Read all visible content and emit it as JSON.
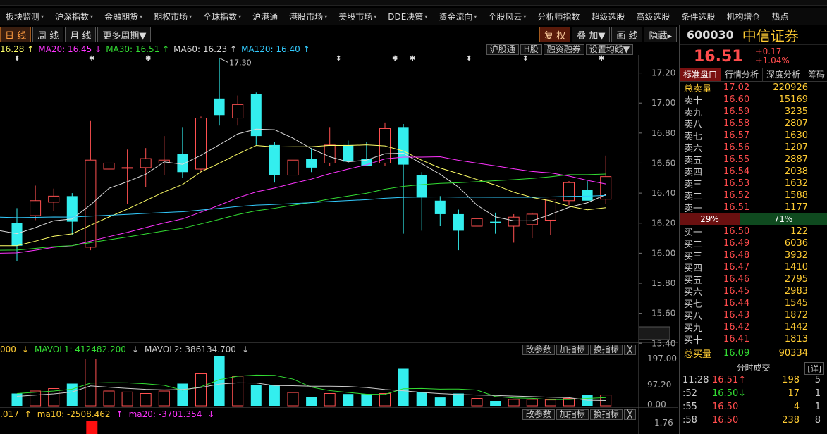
{
  "menu": [
    {
      "label": "板块监测",
      "arrow": true
    },
    {
      "label": "沪深指数",
      "arrow": true
    },
    {
      "label": "金融期货",
      "arrow": true
    },
    {
      "label": "期权市场",
      "arrow": true
    },
    {
      "label": "全球指数",
      "arrow": true
    },
    {
      "label": "沪港通",
      "arrow": false
    },
    {
      "label": "港股市场",
      "arrow": true
    },
    {
      "label": "美股市场",
      "arrow": true
    },
    {
      "label": "DDE决策",
      "arrow": true
    },
    {
      "label": "资金流向",
      "arrow": true
    },
    {
      "label": "个股风云",
      "arrow": true
    },
    {
      "label": "分析师指数",
      "arrow": false
    },
    {
      "label": "超级选股",
      "arrow": false
    },
    {
      "label": "高级选股",
      "arrow": false
    },
    {
      "label": "条件选股",
      "arrow": false
    },
    {
      "label": "机构增仓",
      "arrow": false
    },
    {
      "label": "热点",
      "arrow": false
    }
  ],
  "periods": [
    "日 线",
    "周 线",
    "月 线",
    "更多周期▼"
  ],
  "chart_buttons": [
    "复 权",
    "叠 加▼",
    "画 线",
    "隐藏▸"
  ],
  "ma_legend": [
    {
      "text": "16.28",
      "color": "#ffff66",
      "arrow": "↑"
    },
    {
      "text": "MA20: 16.45",
      "color": "#ff33ff",
      "arrow": "↓"
    },
    {
      "text": "MA30: 16.51",
      "color": "#33dd33",
      "arrow": "↑"
    },
    {
      "text": "MA60: 16.23",
      "color": "#dcdcdc",
      "arrow": "↑"
    },
    {
      "text": "MA120: 16.40",
      "color": "#33ccff",
      "arrow": "↑"
    }
  ],
  "legend_buttons": [
    "沪股通",
    "H股",
    "融资融券",
    "设置均线▼"
  ],
  "vol_legend": {
    "v0": "000",
    "mavol1": "MAVOL1: 412482.200",
    "mavol2": "MAVOL2: 386134.700"
  },
  "vol_buttons": [
    "改参数",
    "加指标",
    "换指标",
    "╳"
  ],
  "ind_legend": {
    "v0": ".017",
    "ma10": "ma10: -2508.462",
    "ma20": "ma20: -3701.354"
  },
  "stock": {
    "code": "600030",
    "name": "中信证券",
    "price": "16.51",
    "change": "+0.17",
    "change_pct": "+1.04%"
  },
  "tabs": [
    "标准盘口",
    "行情分析",
    "深度分析",
    "筹码"
  ],
  "ask_total": {
    "label": "总卖量",
    "price": "17.02",
    "vol": "220926"
  },
  "asks": [
    {
      "label": "卖十",
      "price": "16.60",
      "vol": "15169"
    },
    {
      "label": "卖九",
      "price": "16.59",
      "vol": "3235"
    },
    {
      "label": "卖八",
      "price": "16.58",
      "vol": "2807"
    },
    {
      "label": "卖七",
      "price": "16.57",
      "vol": "1630"
    },
    {
      "label": "卖六",
      "price": "16.56",
      "vol": "1207"
    },
    {
      "label": "卖五",
      "price": "16.55",
      "vol": "2887"
    },
    {
      "label": "卖四",
      "price": "16.54",
      "vol": "2038"
    },
    {
      "label": "卖三",
      "price": "16.53",
      "vol": "1632"
    },
    {
      "label": "卖二",
      "price": "16.52",
      "vol": "1588"
    },
    {
      "label": "卖一",
      "price": "16.51",
      "vol": "1177"
    }
  ],
  "ratio": {
    "buy": "29%",
    "sell": "71%"
  },
  "bids": [
    {
      "label": "买一",
      "price": "16.50",
      "vol": "122"
    },
    {
      "label": "买二",
      "price": "16.49",
      "vol": "6036"
    },
    {
      "label": "买三",
      "price": "16.48",
      "vol": "3932"
    },
    {
      "label": "买四",
      "price": "16.47",
      "vol": "1410"
    },
    {
      "label": "买五",
      "price": "16.46",
      "vol": "2795"
    },
    {
      "label": "买六",
      "price": "16.45",
      "vol": "2983"
    },
    {
      "label": "买七",
      "price": "16.44",
      "vol": "1545"
    },
    {
      "label": "买八",
      "price": "16.43",
      "vol": "1872"
    },
    {
      "label": "买九",
      "price": "16.42",
      "vol": "1442"
    },
    {
      "label": "买十",
      "price": "16.41",
      "vol": "1813"
    }
  ],
  "bid_total": {
    "label": "总买量",
    "price": "16.09",
    "vol": "90334"
  },
  "trades_header": "分时成交",
  "trades_detail": "[详]",
  "trades": [
    {
      "time": "11:28",
      "price": "16.51",
      "dir": "↑",
      "vol": "198",
      "n": "5",
      "color": "red"
    },
    {
      "time": ":52",
      "price": "16.50",
      "dir": "↓",
      "vol": "17",
      "n": "1",
      "color": "green"
    },
    {
      "time": ":55",
      "price": "16.50",
      "dir": "",
      "vol": "4",
      "n": "1",
      "color": "red"
    },
    {
      "time": ":58",
      "price": "16.50",
      "dir": "",
      "vol": "238",
      "n": "8",
      "color": "red"
    }
  ],
  "chart_data": {
    "type": "candlestick",
    "price_axis_labels": [
      "17.20",
      "17.00",
      "16.80",
      "16.60",
      "16.40",
      "16.20",
      "16.00",
      "15.80",
      "15.60",
      "15.40"
    ],
    "price_ylim": [
      15.42,
      17.32
    ],
    "high_marker": "17.30",
    "volume_axis_labels": [
      "197.00",
      "97.20",
      "0.00"
    ],
    "indicator_axis_labels": [
      "1.76"
    ],
    "candles": [
      {
        "o": 16.2,
        "h": 16.3,
        "l": 15.95,
        "c": 16.05
      },
      {
        "o": 16.25,
        "h": 16.45,
        "l": 16.22,
        "c": 16.35
      },
      {
        "o": 16.34,
        "h": 16.43,
        "l": 16.28,
        "c": 16.38
      },
      {
        "o": 16.38,
        "h": 16.4,
        "l": 16.12,
        "c": 16.21
      },
      {
        "o": 16.04,
        "h": 16.88,
        "l": 16.02,
        "c": 16.62
      },
      {
        "o": 16.56,
        "h": 16.72,
        "l": 16.5,
        "c": 16.6
      },
      {
        "o": 16.57,
        "h": 16.69,
        "l": 16.33,
        "c": 16.57
      },
      {
        "o": 16.57,
        "h": 16.7,
        "l": 16.44,
        "c": 16.63
      },
      {
        "o": 16.6,
        "h": 16.78,
        "l": 16.52,
        "c": 16.62
      },
      {
        "o": 16.66,
        "h": 16.84,
        "l": 16.5,
        "c": 16.54
      },
      {
        "o": 16.56,
        "h": 16.91,
        "l": 16.54,
        "c": 16.9
      },
      {
        "o": 17.03,
        "h": 17.3,
        "l": 16.85,
        "c": 16.92
      },
      {
        "o": 16.9,
        "h": 17.05,
        "l": 16.85,
        "c": 16.99
      },
      {
        "o": 17.06,
        "h": 17.07,
        "l": 16.72,
        "c": 16.78
      },
      {
        "o": 16.72,
        "h": 16.74,
        "l": 16.47,
        "c": 16.52
      },
      {
        "o": 16.52,
        "h": 16.67,
        "l": 16.41,
        "c": 16.62
      },
      {
        "o": 16.63,
        "h": 16.7,
        "l": 16.54,
        "c": 16.57
      },
      {
        "o": 16.6,
        "h": 16.84,
        "l": 16.58,
        "c": 16.72
      },
      {
        "o": 16.72,
        "h": 16.75,
        "l": 16.6,
        "c": 16.61
      },
      {
        "o": 16.63,
        "h": 16.74,
        "l": 16.58,
        "c": 16.58
      },
      {
        "o": 16.6,
        "h": 16.87,
        "l": 16.58,
        "c": 16.83
      },
      {
        "o": 16.84,
        "h": 16.86,
        "l": 16.13,
        "c": 16.59
      },
      {
        "o": 16.52,
        "h": 16.54,
        "l": 16.15,
        "c": 16.37
      },
      {
        "o": 16.35,
        "h": 16.38,
        "l": 16.18,
        "c": 16.26
      },
      {
        "o": 16.26,
        "h": 16.29,
        "l": 16.02,
        "c": 16.15
      },
      {
        "o": 16.18,
        "h": 16.27,
        "l": 16.13,
        "c": 16.23
      },
      {
        "o": 16.21,
        "h": 16.27,
        "l": 16.13,
        "c": 16.2
      },
      {
        "o": 16.18,
        "h": 16.26,
        "l": 16.07,
        "c": 16.24
      },
      {
        "o": 16.19,
        "h": 16.27,
        "l": 16.1,
        "c": 16.26
      },
      {
        "o": 16.22,
        "h": 16.36,
        "l": 16.12,
        "c": 16.36
      },
      {
        "o": 16.35,
        "h": 16.48,
        "l": 16.32,
        "c": 16.47
      },
      {
        "o": 16.42,
        "h": 16.48,
        "l": 16.36,
        "c": 16.35
      },
      {
        "o": 16.36,
        "h": 16.65,
        "l": 16.33,
        "c": 16.51
      }
    ],
    "volumes": [
      0.25,
      0.3,
      0.35,
      0.45,
      0.95,
      0.3,
      0.28,
      0.25,
      0.3,
      0.45,
      0.65,
      1.0,
      0.6,
      0.42,
      0.42,
      0.27,
      0.18,
      0.25,
      0.24,
      0.24,
      0.25,
      0.75,
      0.28,
      0.17,
      0.25,
      0.15,
      0.1,
      0.13,
      0.13,
      0.12,
      0.15,
      0.22,
      0.22
    ],
    "indicator_bar_index": 3
  }
}
